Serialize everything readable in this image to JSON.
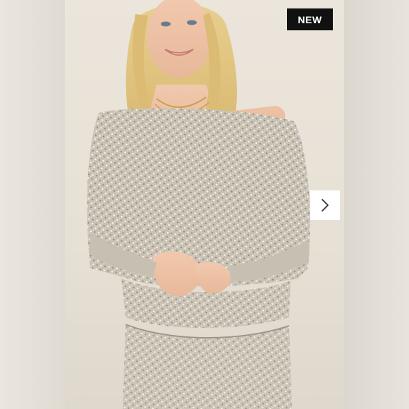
{
  "listing": {
    "badge": "NEW",
    "carousel": {
      "next_icon": "chevron-right-icon"
    }
  },
  "colors": {
    "badge_bg": "#111111",
    "badge_text": "#ffffff",
    "background": "#e9e3d9",
    "garment": "#cfc8bb"
  }
}
